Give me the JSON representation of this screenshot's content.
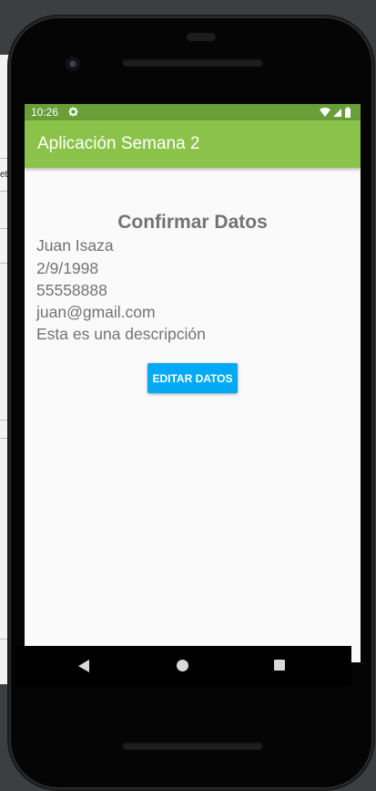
{
  "host": {
    "left_text": "et"
  },
  "status_bar": {
    "time": "10:26",
    "settings_icon": "gear-icon",
    "wifi_icon": "wifi-icon",
    "signal_icon": "signal-icon",
    "battery_icon": "battery-icon"
  },
  "app_bar": {
    "title": "Aplicación Semana 2",
    "color": "#8bc34a",
    "status_color": "#689f38"
  },
  "confirm": {
    "heading": "Confirmar Datos",
    "name": "Juan Isaza",
    "birthdate": "2/9/1998",
    "phone": "55558888",
    "email": "juan@gmail.com",
    "description": "Esta es una descripción"
  },
  "actions": {
    "edit_label": "EDITAR DATOS",
    "edit_color": "#03a9f4"
  },
  "nav": {
    "back_icon": "back-triangle-icon",
    "home_icon": "home-circle-icon",
    "recents_icon": "recents-square-icon"
  }
}
